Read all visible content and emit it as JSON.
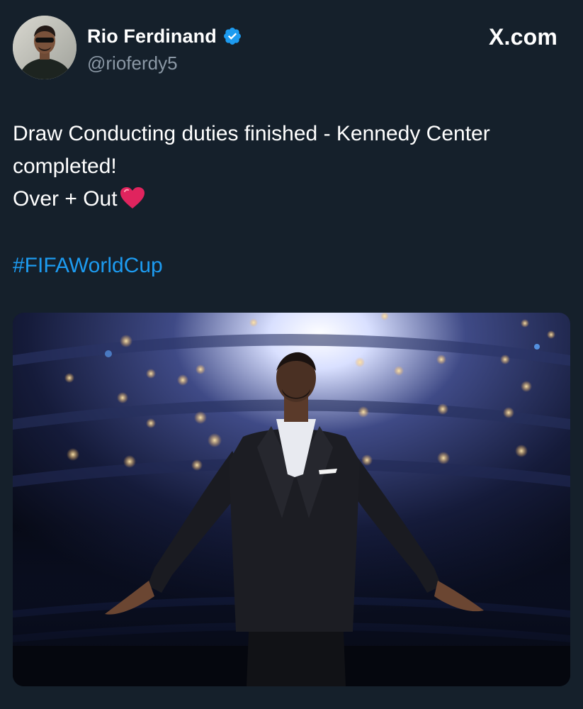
{
  "author": {
    "name": "Rio Ferdinand",
    "handle": "@rioferdy5",
    "verified_icon": "verified-badge-icon",
    "avatar": "profile photo"
  },
  "site_label": "X.com",
  "tweet": {
    "lines": [
      "Draw Conducting duties finished - Kennedy Center",
      "completed!",
      "Over + Out"
    ],
    "emoji": "red-heart-icon",
    "hashtag": "#FIFAWorldCup"
  },
  "media": {
    "type": "photo",
    "description_icon": "photo-image"
  },
  "colors": {
    "background": "#15202b",
    "text": "#ffffff",
    "secondary_text": "#8b98a5",
    "link": "#1d9bf0",
    "verified": "#1d9bf0",
    "heart": "#e0245e"
  }
}
